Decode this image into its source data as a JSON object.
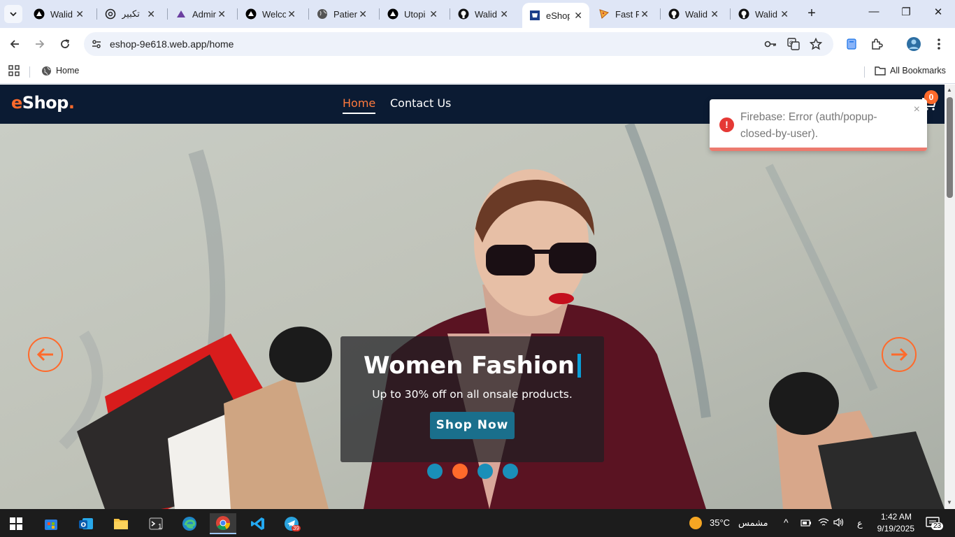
{
  "browser": {
    "tabs": [
      {
        "title": "Walid",
        "icon": "vercel-icon"
      },
      {
        "title": "تكبير",
        "icon": "chatgpt-icon"
      },
      {
        "title": "Admin",
        "icon": "admin-icon"
      },
      {
        "title": "Welco",
        "icon": "vercel-icon"
      },
      {
        "title": "Patien",
        "icon": "globe-icon"
      },
      {
        "title": "Utopi",
        "icon": "vercel-icon"
      },
      {
        "title": "Walid",
        "icon": "github-icon"
      },
      {
        "title": "eShop",
        "icon": "eshop-icon",
        "active": true
      },
      {
        "title": "Fast F",
        "icon": "pizza-icon"
      },
      {
        "title": "Walid",
        "icon": "github-icon"
      },
      {
        "title": "Walid",
        "icon": "github-icon"
      }
    ],
    "url": "eshop-9e618.web.app/home",
    "bookmarks": [
      {
        "label": "Home"
      },
      {
        "label": "All Bookmarks"
      }
    ]
  },
  "site": {
    "logo_main": "e",
    "logo_rest": "Shop",
    "logo_dot": ".",
    "nav": [
      {
        "label": "Home",
        "active": true
      },
      {
        "label": "Contact Us"
      }
    ],
    "cart_count": "0"
  },
  "hero": {
    "title": "Women Fashion",
    "subtitle": "Up to 30% off on all onsale products.",
    "cta": "Shop Now",
    "slide_count": 4,
    "active_slide": 2
  },
  "toast": {
    "message": "Firebase: Error (auth/popup-closed-by-user).",
    "close": "×"
  },
  "taskbar": {
    "weather_temp": "35°C",
    "weather_desc": "مشمس",
    "lang": "ع",
    "time": "1:42 AM",
    "date": "9/19/2025",
    "notif_count": "23",
    "telegram_badge": "39",
    "terminal_badge": "1"
  },
  "colors": {
    "accent": "#ff6a2b",
    "navbar": "#0b1b33",
    "dot": "#1a8fb8",
    "error": "#e53935"
  }
}
